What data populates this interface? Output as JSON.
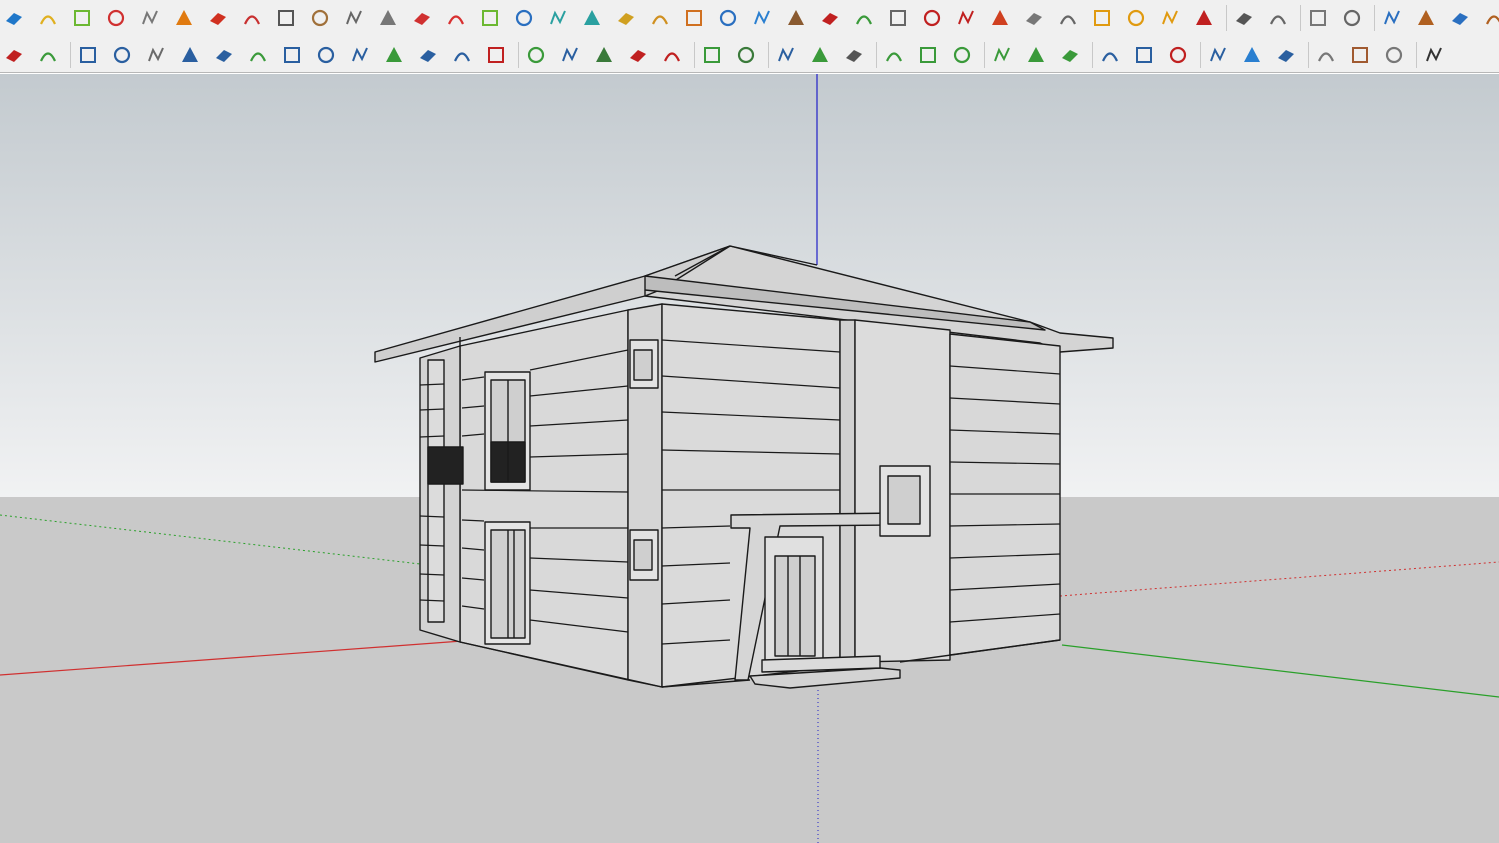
{
  "app": "SketchUp",
  "toolbar_rows": [
    {
      "name": "main-tools",
      "buttons": [
        {
          "name": "blue-solid-icon",
          "color": "#1f77c9"
        },
        {
          "name": "yellow-solid-icon",
          "color": "#e0b020"
        },
        {
          "name": "green-solid-icon",
          "color": "#6cb832"
        },
        {
          "name": "red-solid-icon",
          "color": "#d03030"
        },
        {
          "name": "wireframe-solid-icon",
          "color": "#777777"
        },
        {
          "name": "follow-me-icon",
          "color": "#e07a10"
        },
        {
          "name": "red-box-icon",
          "color": "#d03020"
        },
        {
          "name": "section-plane-icon",
          "color": "#c83030"
        },
        {
          "name": "flag-icon",
          "color": "#555555"
        },
        {
          "name": "wood-box-icon",
          "color": "#a0703a"
        },
        {
          "name": "pipe-icon",
          "color": "#666666"
        },
        {
          "name": "stairs-icon",
          "color": "#777777"
        },
        {
          "name": "curve-points-icon",
          "color": "#d03030"
        },
        {
          "name": "red-cross-icon",
          "color": "#d83030"
        },
        {
          "name": "green-cross-icon",
          "color": "#6cb832"
        },
        {
          "name": "blue-x-icon",
          "color": "#2a6fc0"
        },
        {
          "name": "cone-icon",
          "color": "#2aa0a0"
        },
        {
          "name": "cone-drop-icon",
          "color": "#2aa0a0"
        },
        {
          "name": "triangle-icon",
          "color": "#d0a020"
        },
        {
          "name": "loop-icon",
          "color": "#d09020"
        },
        {
          "name": "loop-cut-icon",
          "color": "#d07020"
        },
        {
          "name": "rotate-loop-icon",
          "color": "#2a6fc0"
        },
        {
          "name": "move-arrows-icon",
          "color": "#2a7fd0"
        },
        {
          "name": "box-extrude-icon",
          "color": "#8a5a30"
        },
        {
          "name": "undo-icon",
          "color": "#c02020"
        },
        {
          "name": "green-shape-icon",
          "color": "#3a9a3a"
        },
        {
          "name": "arrow-box-icon",
          "color": "#666666"
        },
        {
          "name": "red-arrow-box-icon",
          "color": "#c02020"
        },
        {
          "name": "red-arrow-box-2-icon",
          "color": "#c02020"
        },
        {
          "name": "red-diamond-icon",
          "color": "#d04020"
        },
        {
          "name": "grid-box-icon",
          "color": "#777777"
        },
        {
          "name": "frame-icon",
          "color": "#666666"
        },
        {
          "name": "orange-grid-icon",
          "color": "#e09a10"
        },
        {
          "name": "orange-grid-2-icon",
          "color": "#e09a10"
        },
        {
          "name": "orange-grid-3-icon",
          "color": "#e09a10"
        },
        {
          "name": "explode-icon",
          "color": "#c02020"
        },
        {
          "name": "dotted-curve-icon",
          "color": "#555555"
        },
        {
          "name": "grid-nodes-icon",
          "color": "#666666"
        },
        {
          "name": "pencil-icon",
          "color": "#777777"
        },
        {
          "name": "dimension-icon",
          "color": "#666666"
        },
        {
          "name": "paint-roller-icon",
          "color": "#2a6fc0"
        },
        {
          "name": "paint-bucket-icon",
          "color": "#b06020"
        },
        {
          "name": "material-icon",
          "color": "#2a6fc0"
        },
        {
          "name": "material-2-icon",
          "color": "#b06020"
        }
      ]
    },
    {
      "name": "drawing-tools",
      "buttons": [
        {
          "name": "lasso-icon",
          "color": "#c02020"
        },
        {
          "name": "sandbox-icon",
          "color": "#3a9a3a"
        },
        {
          "name": "arc-curve-icon",
          "color": "#2a5fa0"
        },
        {
          "name": "freehand-icon",
          "color": "#2a5fa0"
        },
        {
          "name": "freehand-2-icon",
          "color": "#6a6a6a"
        },
        {
          "name": "freehand-3-icon",
          "color": "#2a5fa0"
        },
        {
          "name": "bezier-icon",
          "color": "#2a5fa0"
        },
        {
          "name": "arc-icon",
          "color": "#3a9a3a"
        },
        {
          "name": "rectangle-icon",
          "color": "#2a5fa0"
        },
        {
          "name": "spiral-icon",
          "color": "#2a5fa0"
        },
        {
          "name": "arc-2-icon",
          "color": "#2a5fa0"
        },
        {
          "name": "zigzag-icon",
          "color": "#3a9a3a"
        },
        {
          "name": "hook-icon",
          "color": "#2a5fa0"
        },
        {
          "name": "arc-3-icon",
          "color": "#2a5fa0"
        },
        {
          "name": "arc-4-icon",
          "color": "#c02020"
        },
        {
          "name": "line-icon",
          "color": "#3a9a3a"
        },
        {
          "name": "polygon-icon",
          "color": "#2a5fa0"
        },
        {
          "name": "wrench-icon",
          "color": "#3a7a3a"
        },
        {
          "name": "circle-icon",
          "color": "#c02020"
        },
        {
          "name": "pie-icon",
          "color": "#c02020"
        },
        {
          "name": "terrain-icon",
          "color": "#3a9a3a"
        },
        {
          "name": "house-terrain-icon",
          "color": "#3a7a3a"
        },
        {
          "name": "select-cursor-icon",
          "color": "#2a5fa0"
        },
        {
          "name": "scale-up-icon",
          "color": "#3a9a3a"
        },
        {
          "name": "scale-down-icon",
          "color": "#555555"
        },
        {
          "name": "align-lines-icon",
          "color": "#3a9a3a"
        },
        {
          "name": "align-lines-add-icon",
          "color": "#3a9a3a"
        },
        {
          "name": "align-lines-remove-icon",
          "color": "#3a9a3a"
        },
        {
          "name": "line-segment-icon",
          "color": "#3a9a3a"
        },
        {
          "name": "line-segment-add-icon",
          "color": "#3a9a3a"
        },
        {
          "name": "line-segment-remove-icon",
          "color": "#3a9a3a"
        },
        {
          "name": "panel-cross-icon",
          "color": "#2a5fa0"
        },
        {
          "name": "panel-grid-icon",
          "color": "#2a5fa0"
        },
        {
          "name": "panel-grid-red-icon",
          "color": "#c02020"
        },
        {
          "name": "window-grid-icon",
          "color": "#2a5fa0"
        },
        {
          "name": "window-grid-2-icon",
          "color": "#2a7fd0"
        },
        {
          "name": "window-cross-icon",
          "color": "#2a5fa0"
        },
        {
          "name": "roof-tile-icon",
          "color": "#777777"
        },
        {
          "name": "roof-tile-2-icon",
          "color": "#a05a30"
        },
        {
          "name": "dome-icon",
          "color": "#777777"
        },
        {
          "name": "checker-icon",
          "color": "#333333"
        }
      ]
    }
  ],
  "viewport": {
    "sky_color": "#c5ccd0",
    "ground_color": "#c9c9c9",
    "axis_colors": {
      "red": "#d03030",
      "green": "#2aa02a",
      "blue": "#2020c8"
    }
  }
}
